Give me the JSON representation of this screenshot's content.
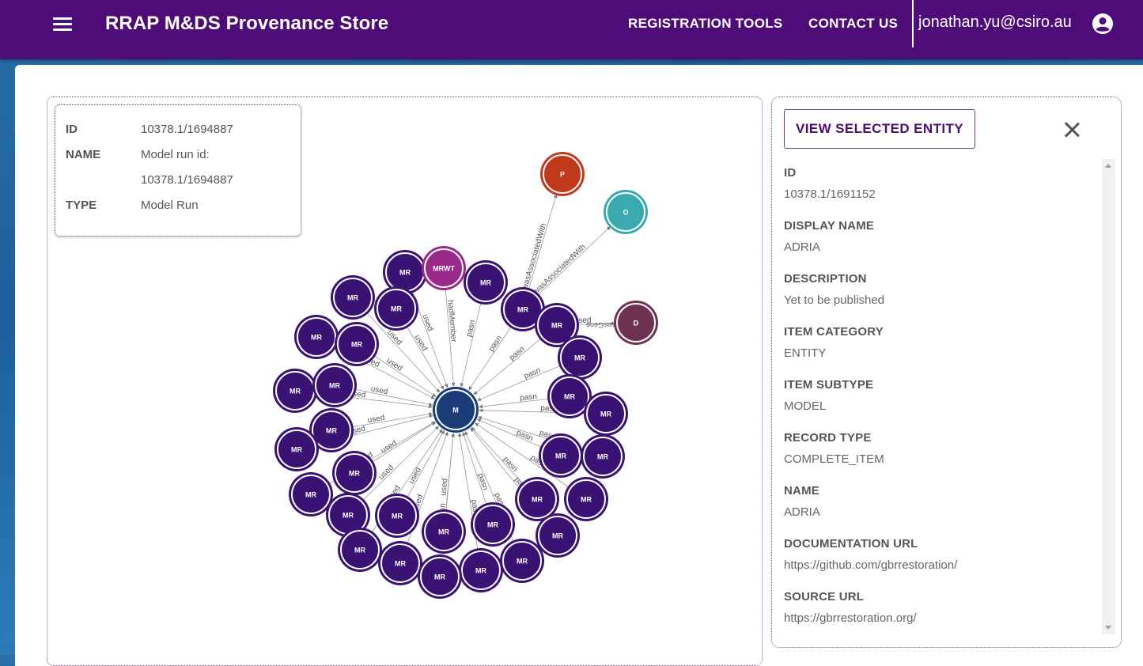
{
  "header": {
    "title": "RRAP M&DS Provenance Store",
    "nav": [
      "REGISTRATION TOOLS",
      "CONTACT US"
    ],
    "user": "jonathan.yu@csiro.au"
  },
  "info_card": {
    "rows": [
      {
        "label": "ID",
        "value": "10378.1/1694887"
      },
      {
        "label": "NAME",
        "value": "Model run id:"
      },
      {
        "label": "",
        "value": "10378.1/1694887"
      },
      {
        "label": "TYPE",
        "value": "Model Run"
      }
    ]
  },
  "graph": {
    "center": {
      "label": "M",
      "color": "#1a3d7a"
    },
    "outer_nodes": [
      {
        "label": "P",
        "color": "#c0391b",
        "edge": "wasAssociatedWith"
      },
      {
        "label": "O",
        "color": "#3aa9b0",
        "edge": "wasAssociatedWith"
      },
      {
        "label": "D",
        "color": "#6e3350",
        "edge": "used"
      },
      {
        "label": "MRWT",
        "color": "#9a2a8a",
        "edge": "hadMember"
      }
    ],
    "mr_label": "MR",
    "mr_color": "#3a1273",
    "edge_used": "used",
    "edge_pasn": "pasn",
    "edge_wasGen": "wasGene"
  },
  "detail": {
    "view_button": "VIEW SELECTED ENTITY",
    "properties": [
      {
        "label": "ID",
        "value": "10378.1/1691152"
      },
      {
        "label": "DISPLAY NAME",
        "value": "ADRIA"
      },
      {
        "label": "DESCRIPTION",
        "value": "Yet to be published"
      },
      {
        "label": "ITEM CATEGORY",
        "value": "ENTITY"
      },
      {
        "label": "ITEM SUBTYPE",
        "value": "MODEL"
      },
      {
        "label": "RECORD TYPE",
        "value": "COMPLETE_ITEM"
      },
      {
        "label": "NAME",
        "value": "ADRIA"
      },
      {
        "label": "DOCUMENTATION URL",
        "value": "https://github.com/gbrrestoration/"
      },
      {
        "label": "SOURCE URL",
        "value": "https://gbrrestoration.org/"
      }
    ]
  },
  "colors": {
    "appbar": "#4e0c78",
    "accent": "#4e0c78"
  }
}
